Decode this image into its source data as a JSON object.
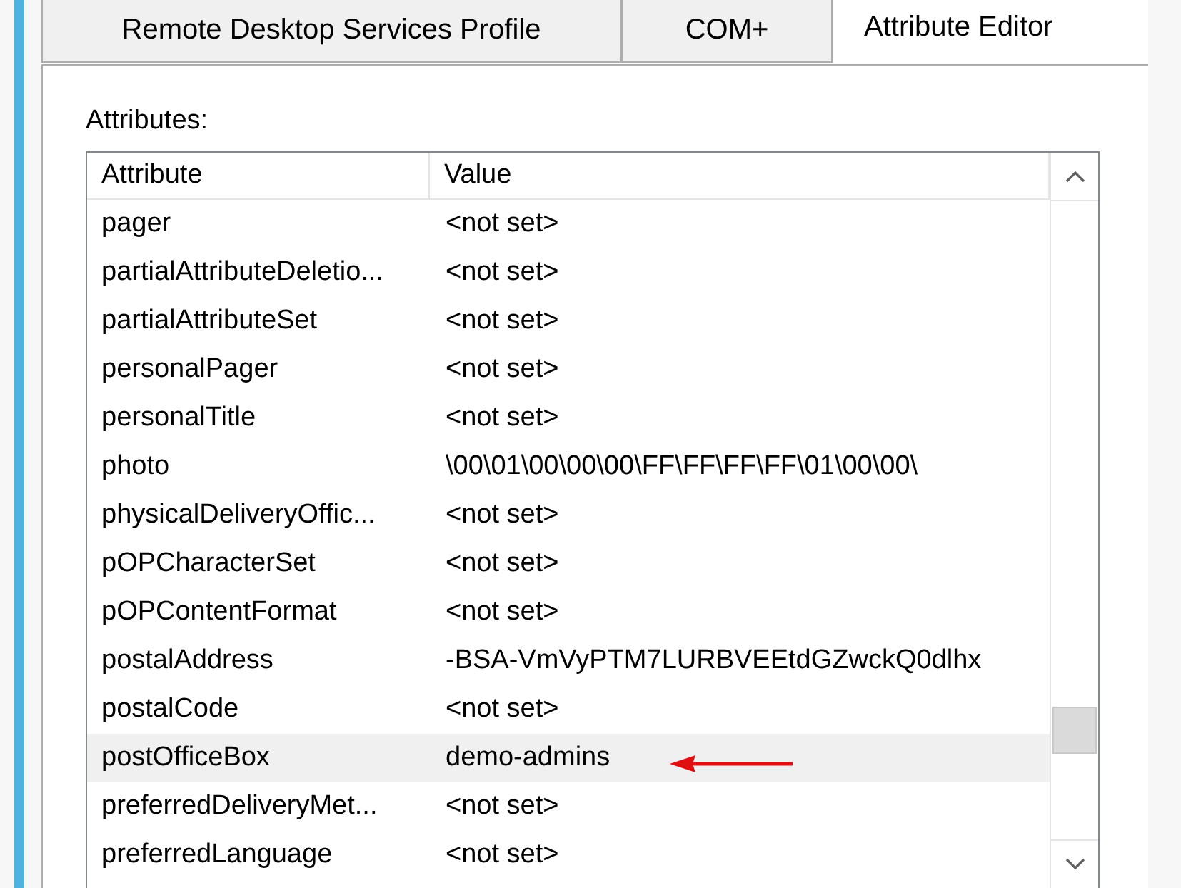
{
  "tabs": [
    {
      "label": "Remote Desktop Services Profile",
      "selected": false
    },
    {
      "label": "COM+",
      "selected": false
    },
    {
      "label": "Attribute Editor",
      "selected": true
    }
  ],
  "attributes_label": "Attributes:",
  "table": {
    "columns": [
      "Attribute",
      "Value"
    ],
    "rows": [
      {
        "attribute": "pager",
        "value": "<not set>",
        "selected": false
      },
      {
        "attribute": "partialAttributeDeletio...",
        "value": "<not set>",
        "selected": false
      },
      {
        "attribute": "partialAttributeSet",
        "value": "<not set>",
        "selected": false
      },
      {
        "attribute": "personalPager",
        "value": "<not set>",
        "selected": false
      },
      {
        "attribute": "personalTitle",
        "value": "<not set>",
        "selected": false
      },
      {
        "attribute": "photo",
        "value": "\\00\\01\\00\\00\\00\\FF\\FF\\FF\\FF\\01\\00\\00\\",
        "selected": false
      },
      {
        "attribute": "physicalDeliveryOffic...",
        "value": "<not set>",
        "selected": false
      },
      {
        "attribute": "pOPCharacterSet",
        "value": "<not set>",
        "selected": false
      },
      {
        "attribute": "pOPContentFormat",
        "value": "<not set>",
        "selected": false
      },
      {
        "attribute": "postalAddress",
        "value": "-BSA-VmVyPTM7LURBVEEtdGZwckQ0dlhx",
        "selected": false
      },
      {
        "attribute": "postalCode",
        "value": "<not set>",
        "selected": false
      },
      {
        "attribute": "postOfficeBox",
        "value": "demo-admins",
        "selected": true
      },
      {
        "attribute": "preferredDeliveryMet...",
        "value": "<not set>",
        "selected": false
      },
      {
        "attribute": "preferredLanguage",
        "value": "<not set>",
        "selected": false
      }
    ]
  }
}
